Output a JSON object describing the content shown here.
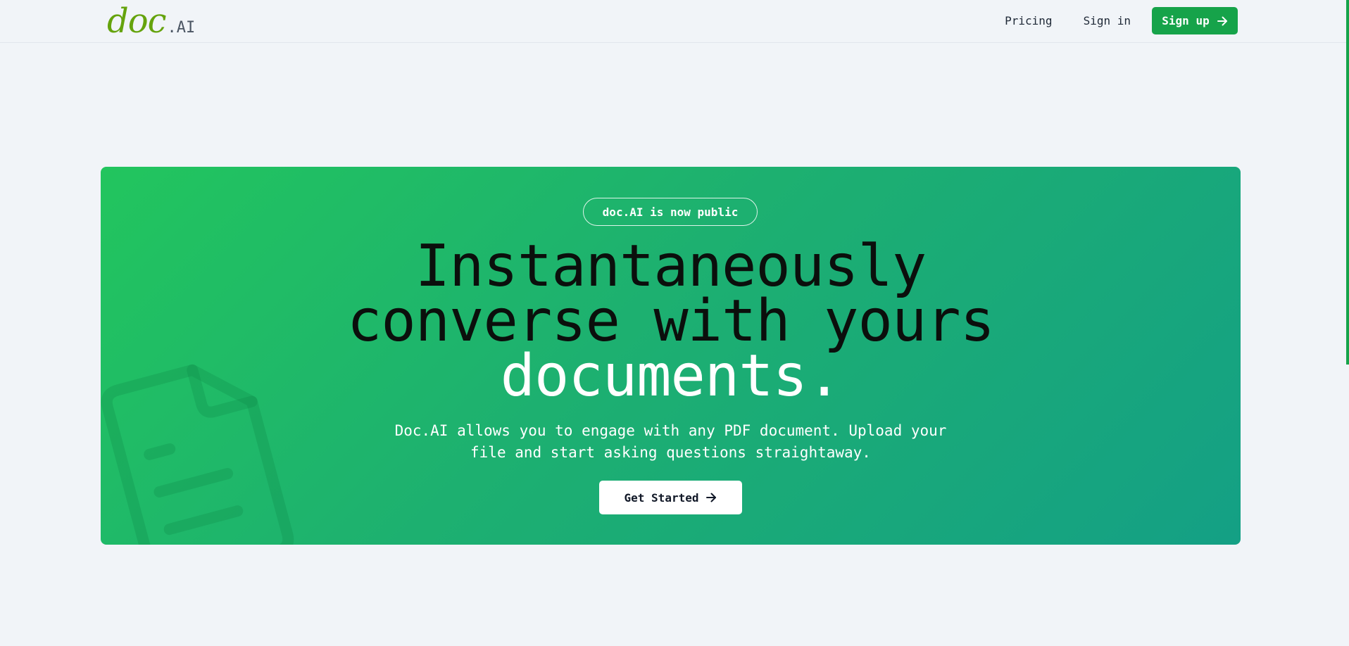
{
  "brand": {
    "logo_script": "doc",
    "logo_suffix": ".AI"
  },
  "nav": {
    "pricing": "Pricing",
    "sign_in": "Sign in",
    "sign_up": "Sign up",
    "sign_up_icon": "arrow-right-icon"
  },
  "hero": {
    "badge": "doc.AI is now public",
    "headline_line1": "Instantaneously",
    "headline_line2": "converse with yours",
    "headline_highlight": "documents.",
    "subtext_line1": "Doc.AI allows you to engage with any PDF document. Upload your",
    "subtext_line2": "file and start asking questions straightaway.",
    "cta_label": "Get Started",
    "cta_icon": "arrow-right-icon",
    "background_icon": "document-icon"
  },
  "colors": {
    "accent": "#16a34a",
    "logo_green": "#65a30d",
    "hero_gradient_start": "#22c55e",
    "hero_gradient_end": "#14a085",
    "page_background": "#f1f4f8"
  }
}
